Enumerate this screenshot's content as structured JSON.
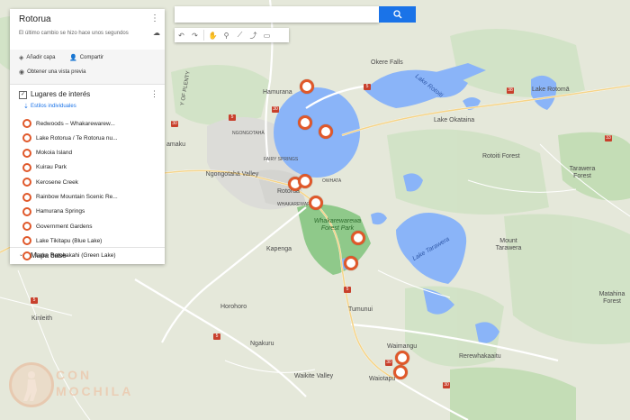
{
  "panel": {
    "title": "Rotorua",
    "subtitle": "El último cambio se hizo hace unos segundos",
    "actions": {
      "add_layer": "Añadir capa",
      "share": "Compartir",
      "preview": "Obtener una vista previa"
    },
    "layer": {
      "title": "Lugares de interés",
      "styles_link": "Estilos individuales",
      "items": [
        "Redwoods – Whakarewarew...",
        "Lake Rotorua / Te Rotorua nu...",
        "Mokoia Island",
        "Kuirau Park",
        "Kerosene Creek",
        "Rainbow Mountain Scenic Re...",
        "Hamurana Springs",
        "Government Gardens",
        "Lake Tikitapu (Blue Lake)",
        "Lake Rotokakahi (Green Lake)"
      ]
    },
    "base_map": "Mapa base"
  },
  "search": {
    "placeholder": "",
    "button_icon": "search-icon"
  },
  "toolbar": {
    "icons": [
      "undo-icon",
      "redo-icon",
      "hand-icon",
      "marker-icon",
      "line-icon",
      "directions-icon",
      "ruler-icon"
    ]
  },
  "map": {
    "places": {
      "okere_falls": "Okere Falls",
      "hamurana": "Hamurana",
      "lake_rotoiti": "Lake Rotoiti",
      "lake_rotoma": "Lake Rotomā",
      "lake_okataina": "Lake Okataina",
      "rotoiti_forest": "Rotoiti Forest",
      "tarawera_forest": "Tarawera Forest",
      "ngongotaha": "NGONGOTAHĀ",
      "fairy_springs": "FAIRY SPRINGS",
      "ngongotaha_valley": "Ngongotahā Valley",
      "rotorua": "Rotorua",
      "owhata": "OWHATA",
      "whakarewarewa": "WHAKAREWAREWA",
      "whakarewarewa_forest_park": "Whakarewarewa Forest Park",
      "kapenga": "Kapenga",
      "lake_tarawera": "Lake Tarawera",
      "mount_tarawera": "Mount Tarawera",
      "matahina_forest": "Matahina Forest",
      "tumunui": "Tumunui",
      "horohoro": "Horohoro",
      "ngakuru": "Ngakuru",
      "kinleith": "Kinleith",
      "waimangu": "Waimangu",
      "rerewhakaaitu": "Rerewhakaaitu",
      "waiotapu": "Waiotapu",
      "waikite_valley": "Waikite Valley",
      "mamaku": "amaku",
      "plenty": "Y OF PLENTY"
    },
    "road_labels": [
      "30",
      "30",
      "5",
      "5",
      "5",
      "38",
      "33",
      "5",
      "5",
      "30",
      "30"
    ]
  },
  "watermark": {
    "line1": "CON",
    "line2": "MOCHILA"
  }
}
